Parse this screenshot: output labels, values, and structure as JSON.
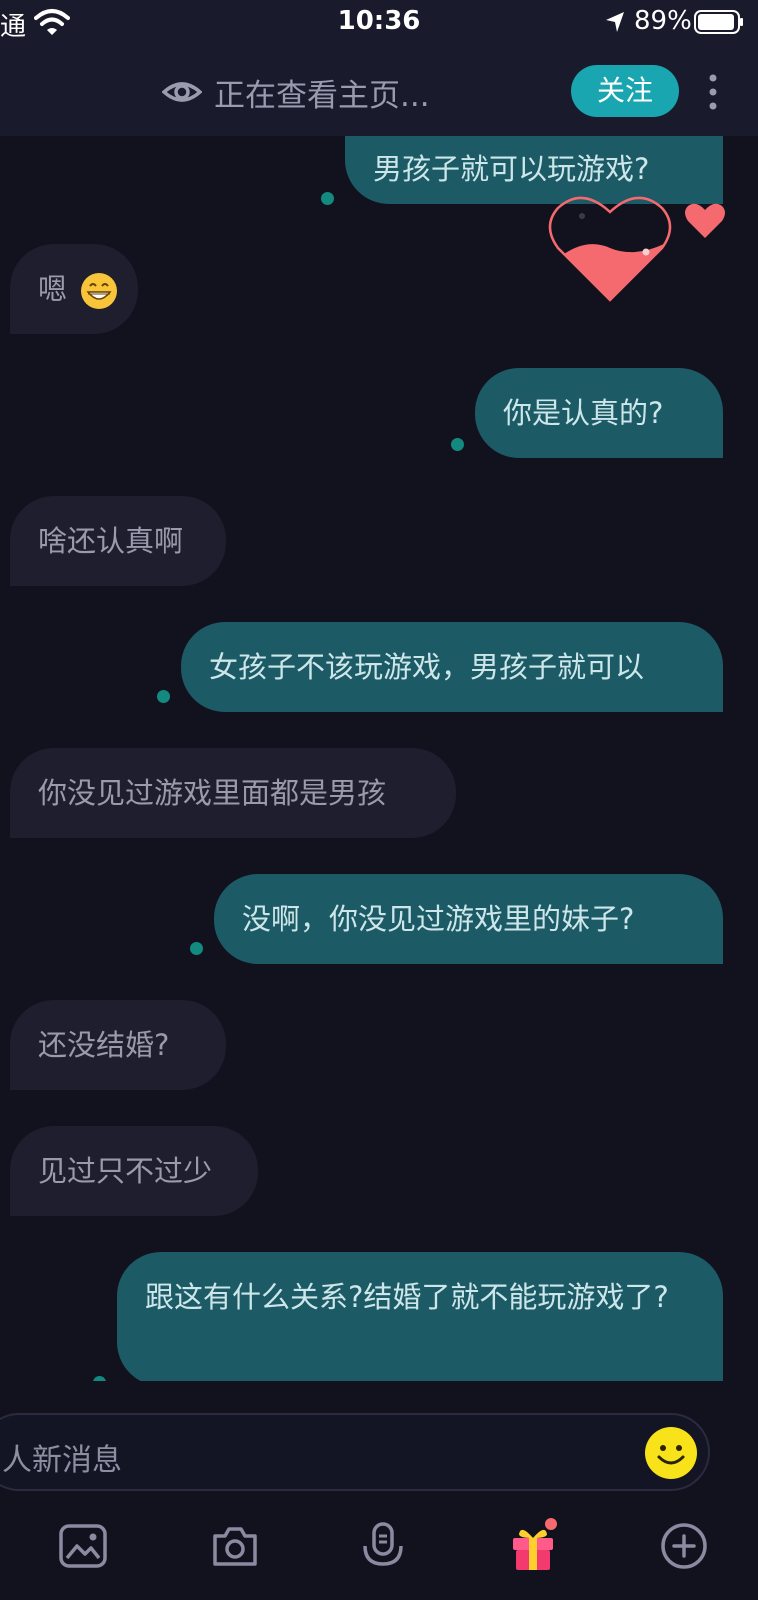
{
  "status_bar": {
    "carrier": "通",
    "time": "10:36",
    "battery": "89%"
  },
  "header": {
    "viewing_text": "正在查看主页...",
    "follow_label": "关注"
  },
  "messages": [
    {
      "side": "out",
      "text": "男孩子就可以玩游戏?"
    },
    {
      "side": "in",
      "text": "嗯",
      "emoji": "grinning-face-emoji"
    },
    {
      "side": "out",
      "text": "你是认真的?"
    },
    {
      "side": "in",
      "text": "啥还认真啊"
    },
    {
      "side": "out",
      "text": "女孩子不该玩游戏，男孩子就可以"
    },
    {
      "side": "in",
      "text": "你没见过游戏里面都是男孩"
    },
    {
      "side": "out",
      "text": "没啊，你没见过游戏里的妹子?"
    },
    {
      "side": "in",
      "text": "还没结婚?"
    },
    {
      "side": "in",
      "text": "见过只不过少"
    },
    {
      "side": "out",
      "text": "跟这有什么关系?结婚了就不能玩游戏了?"
    }
  ],
  "input": {
    "placeholder": "人新消息"
  },
  "icons": {
    "toolbar": [
      "image-icon",
      "camera-icon",
      "microphone-icon",
      "gift-icon",
      "plus-icon"
    ],
    "input": "smiley-emoji-icon",
    "reaction": "heart-icon"
  },
  "colors": {
    "background": "#12121f",
    "outgoing_bubble": "#1c5a66",
    "incoming_bubble": "#1e1e2e",
    "accent": "#1aa6b0",
    "heart": "#f46a6f"
  }
}
